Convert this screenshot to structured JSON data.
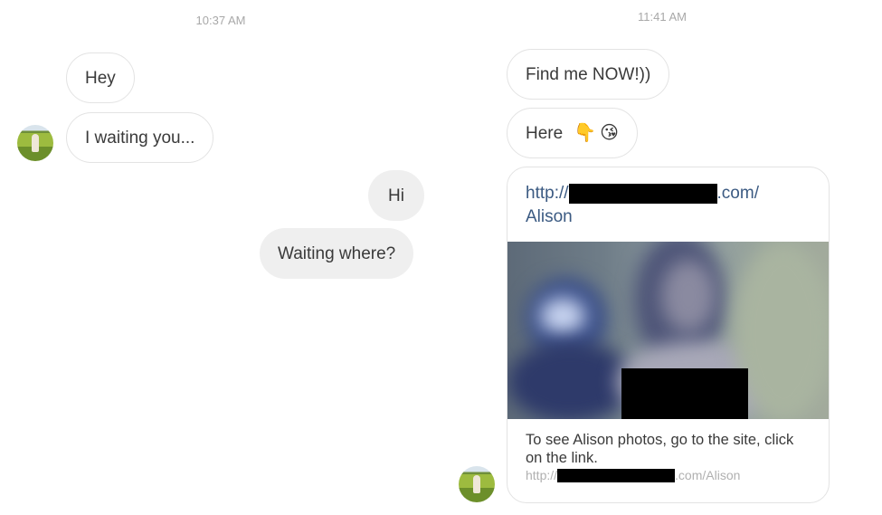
{
  "left_thread": {
    "timestamp": "10:37 AM",
    "messages": [
      {
        "direction": "received",
        "text": "Hey"
      },
      {
        "direction": "received",
        "text": "I waiting you..."
      },
      {
        "direction": "sent",
        "text": "Hi"
      },
      {
        "direction": "sent",
        "text": "Waiting where?"
      }
    ]
  },
  "right_thread": {
    "timestamp": "11:41 AM",
    "messages": [
      {
        "direction": "received",
        "text": "Find me NOW!))"
      },
      {
        "direction": "received",
        "text": "Here",
        "emojis": [
          "👇",
          "😘"
        ]
      }
    ],
    "link_card": {
      "url_prefix": "http://",
      "url_suffix": ".com/",
      "url_path": "Alison",
      "url_redacted": true,
      "preview_image": "blurred-photo-redacted",
      "description": "To see Alison photos, go to the site, click on the link.",
      "link_prefix": "http://",
      "link_suffix": ".com/Alison"
    }
  }
}
